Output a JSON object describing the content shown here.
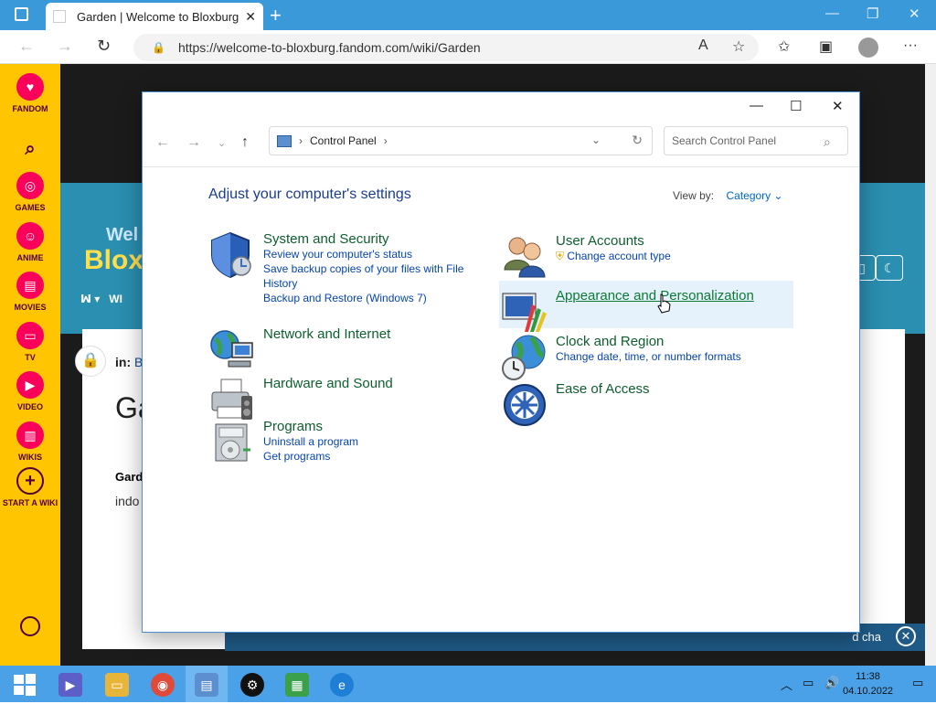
{
  "browser": {
    "tab_title": "Garden | Welcome to Bloxburg W",
    "tab_close": "✕",
    "new_tab": "+",
    "url": "https://welcome-to-bloxburg.fandom.com/wiki/Garden",
    "win_min": "—",
    "win_restore": "❐",
    "win_close": "✕"
  },
  "fandom_sidebar": {
    "items": [
      {
        "label": "FANDOM"
      },
      {
        "label": "GAMES"
      },
      {
        "label": "ANIME"
      },
      {
        "label": "MOVIES"
      },
      {
        "label": "TV"
      },
      {
        "label": "VIDEO"
      },
      {
        "label": "WIKIS"
      },
      {
        "label": "START A WIKI"
      }
    ]
  },
  "page": {
    "welcome": "Wel",
    "bloxburg": "Blox",
    "in_label": "in:",
    "in_value": "B",
    "page_title": "Ga",
    "bold_word": "Gard",
    "body_word": "indo",
    "banner_text": "d cha"
  },
  "control_panel": {
    "breadcrumb": "Control Panel",
    "search_placeholder": "Search Control Panel",
    "heading": "Adjust your computer's settings",
    "view_by_label": "View by:",
    "view_by_value": "Category",
    "left_categories": [
      {
        "title": "System and Security",
        "links": [
          "Review your computer's status",
          "Save backup copies of your files with File History",
          "Backup and Restore (Windows 7)"
        ]
      },
      {
        "title": "Network and Internet",
        "links": []
      },
      {
        "title": "Hardware and Sound",
        "links": []
      },
      {
        "title": "Programs",
        "links": [
          "Uninstall a program",
          "Get programs"
        ]
      }
    ],
    "right_categories": [
      {
        "title": "User Accounts",
        "links": [
          "Change account type"
        ]
      },
      {
        "title": "Appearance and Personalization",
        "links": []
      },
      {
        "title": "Clock and Region",
        "links": [
          "Change date, time, or number formats"
        ]
      },
      {
        "title": "Ease of Access",
        "links": []
      }
    ]
  },
  "taskbar": {
    "time": "11:38",
    "date": "04.10.2022"
  }
}
